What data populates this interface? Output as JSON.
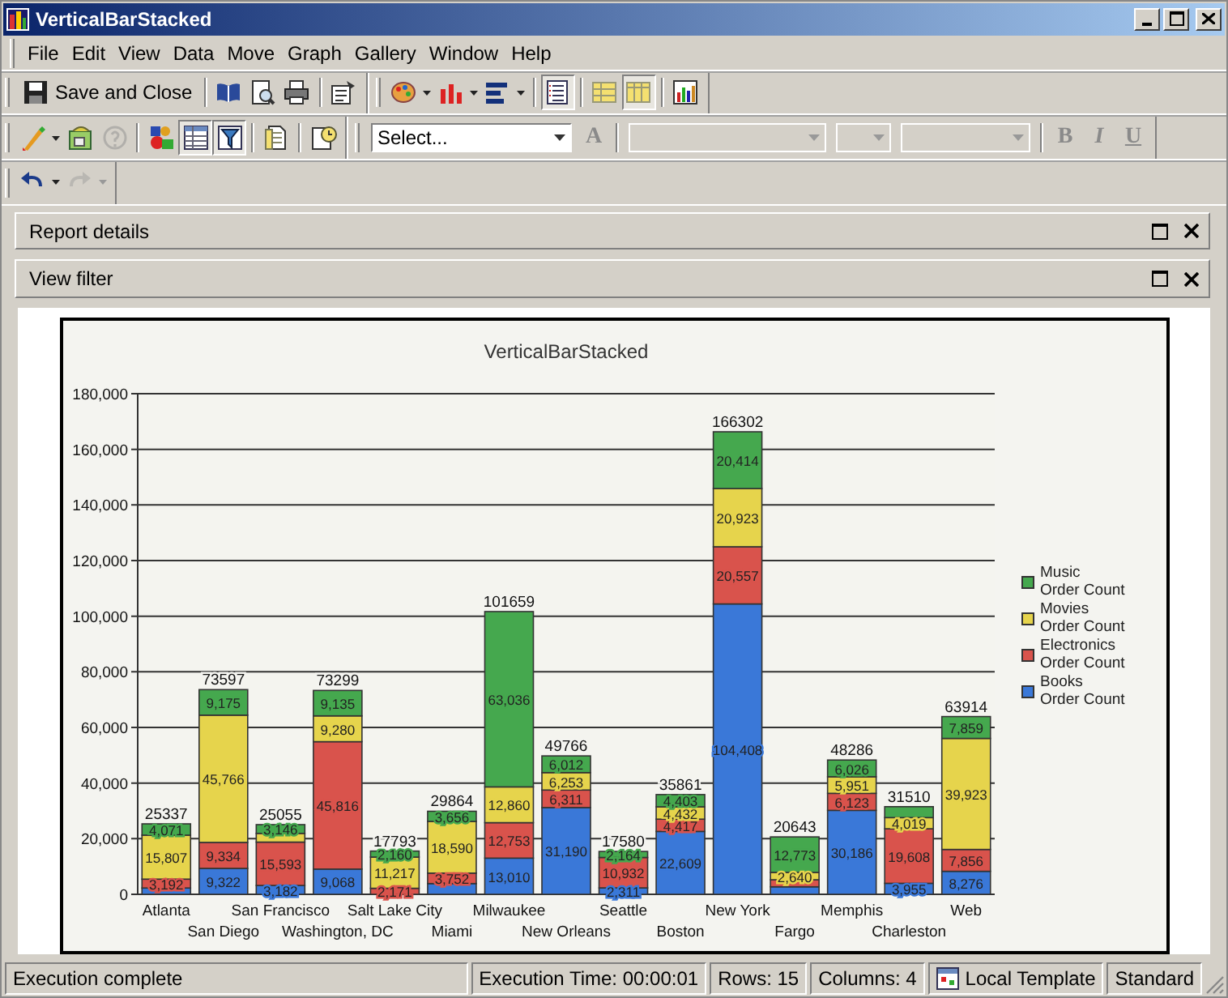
{
  "window": {
    "title": "VerticalBarStacked"
  },
  "menu": [
    "File",
    "Edit",
    "View",
    "Data",
    "Move",
    "Graph",
    "Gallery",
    "Window",
    "Help"
  ],
  "toolbar_rows": [
    {
      "bands": [
        {
          "items": [
            {
              "kind": "save",
              "label": "Save and Close",
              "pressed": false,
              "disabled": false,
              "dropdown": false
            },
            {
              "kind": "separator"
            },
            {
              "kind": "book",
              "pressed": false,
              "disabled": false,
              "dropdown": false
            },
            {
              "kind": "preview",
              "pressed": false,
              "disabled": false,
              "dropdown": false
            },
            {
              "kind": "print",
              "pressed": false,
              "disabled": false,
              "dropdown": false
            },
            {
              "kind": "separator"
            },
            {
              "kind": "properties",
              "pressed": false,
              "disabled": false,
              "dropdown": false
            }
          ]
        },
        {
          "items": [
            {
              "kind": "palette",
              "pressed": false,
              "disabled": false,
              "dropdown": true
            },
            {
              "kind": "bar-chart",
              "pressed": false,
              "disabled": false,
              "dropdown": true
            },
            {
              "kind": "hbar-chart",
              "pressed": false,
              "disabled": false,
              "dropdown": true
            },
            {
              "kind": "separator"
            },
            {
              "kind": "list",
              "pressed": true,
              "disabled": false,
              "dropdown": false
            },
            {
              "kind": "separator"
            },
            {
              "kind": "grid",
              "pressed": false,
              "disabled": false,
              "dropdown": false
            },
            {
              "kind": "columns",
              "pressed": true,
              "disabled": false,
              "dropdown": false
            },
            {
              "kind": "separator"
            },
            {
              "kind": "chart-export",
              "pressed": false,
              "disabled": false,
              "dropdown": false
            }
          ]
        }
      ]
    },
    {
      "bands": [
        {
          "items": [
            {
              "kind": "wand",
              "pressed": false,
              "disabled": false,
              "dropdown": true
            },
            {
              "kind": "image",
              "pressed": false,
              "disabled": false,
              "dropdown": false
            },
            {
              "kind": "help",
              "pressed": false,
              "disabled": true,
              "dropdown": false
            },
            {
              "kind": "separator"
            },
            {
              "kind": "shapes",
              "pressed": false,
              "disabled": false,
              "dropdown": false
            },
            {
              "kind": "table",
              "pressed": true,
              "disabled": false,
              "dropdown": false
            },
            {
              "kind": "filter",
              "pressed": true,
              "disabled": false,
              "dropdown": false
            },
            {
              "kind": "separator"
            },
            {
              "kind": "page",
              "pressed": false,
              "disabled": false,
              "dropdown": false
            },
            {
              "kind": "separator"
            },
            {
              "kind": "clock",
              "pressed": false,
              "disabled": false,
              "dropdown": false
            }
          ]
        },
        {
          "items": [
            {
              "kind": "combo",
              "value": "Select...",
              "disabled": false
            },
            {
              "kind": "font-color",
              "label": "A",
              "pressed": false,
              "disabled": true,
              "dropdown": false
            },
            {
              "kind": "separator"
            },
            {
              "kind": "font-combo",
              "disabled": true
            },
            {
              "kind": "size-combo",
              "disabled": true
            },
            {
              "kind": "style-combo",
              "disabled": true
            },
            {
              "kind": "separator"
            },
            {
              "kind": "bold",
              "label": "B",
              "pressed": false,
              "disabled": true,
              "dropdown": false
            },
            {
              "kind": "italic",
              "label": "I",
              "pressed": false,
              "disabled": true,
              "dropdown": false
            },
            {
              "kind": "underline",
              "label": "U",
              "pressed": false,
              "disabled": true,
              "dropdown": false
            }
          ]
        }
      ]
    },
    {
      "bands": [
        {
          "items": [
            {
              "kind": "undo",
              "pressed": false,
              "disabled": false,
              "dropdown": true
            },
            {
              "kind": "redo",
              "pressed": false,
              "disabled": true,
              "dropdown": true
            }
          ]
        }
      ]
    }
  ],
  "panels": [
    {
      "title": "Report details"
    },
    {
      "title": "View filter"
    }
  ],
  "chart": {
    "chart_data": {
      "type": "bar",
      "title": "VerticalBarStacked",
      "stacked": true,
      "orientation": "vertical",
      "data_labels": true,
      "grid": true,
      "legend": "right",
      "categories": [
        "Atlanta",
        "San Diego",
        "San Francisco",
        "Washington, DC",
        "Salt Lake City",
        "Miami",
        "Milwaukee",
        "New Orleans",
        "Seattle",
        "Boston",
        "New York",
        "Fargo",
        "Memphis",
        "Charleston",
        "Web"
      ],
      "ylim": [
        0,
        180000
      ],
      "yticks": [
        {
          "value": 0,
          "label": "0"
        },
        {
          "value": 20000,
          "label": "20,000"
        },
        {
          "value": 40000,
          "label": "40,000"
        },
        {
          "value": 60000,
          "label": "60,000"
        },
        {
          "value": 80000,
          "label": "80,000"
        },
        {
          "value": 100000,
          "label": "100,000"
        },
        {
          "value": 120000,
          "label": "120,000"
        },
        {
          "value": 140000,
          "label": "140,000"
        },
        {
          "value": 160000,
          "label": "160,000"
        },
        {
          "value": 180000,
          "label": "180,000"
        }
      ],
      "series": [
        {
          "name": "Books Order Count",
          "color": "#3a78d8",
          "values": [
            2267,
            9322,
            3182,
            9068,
            null,
            3866,
            13010,
            31190,
            2311,
            22609,
            104408,
            2705,
            30186,
            3955,
            8276
          ],
          "value_labels": [
            null,
            "9,322",
            "3,182",
            "9,068",
            null,
            null,
            "13,010",
            "31,190",
            "2,311",
            "22,609",
            "104,408",
            null,
            "30,186",
            "3,955",
            "8,276"
          ]
        },
        {
          "name": "Electronics Order Count",
          "color": "#d9534c",
          "values": [
            3192,
            9334,
            15593,
            45816,
            2171,
            3752,
            12753,
            6311,
            10932,
            4417,
            20557,
            2525,
            6123,
            19608,
            7856
          ],
          "value_labels": [
            "3,192",
            "9,334",
            "15,593",
            "45,816",
            "2,171",
            "3,752",
            "12,753",
            "6,311",
            "10,932",
            "4,417",
            "20,557",
            null,
            "6,123",
            "19,608",
            "7,856"
          ]
        },
        {
          "name": "Movies Order Count",
          "color": "#e6d44c",
          "values": [
            15807,
            45766,
            3134,
            9280,
            11217,
            18590,
            12860,
            6253,
            null,
            4432,
            20923,
            2640,
            5951,
            4019,
            39923
          ],
          "value_labels": [
            "15,807",
            "45,766",
            null,
            "9,280",
            "11,217",
            "18,590",
            "12,860",
            "6,253",
            null,
            "4,432",
            "20,923",
            "2,640",
            "5,951",
            "4,019",
            "39,923"
          ]
        },
        {
          "name": "Music Order Count",
          "color": "#45a84e",
          "values": [
            4071,
            9175,
            3146,
            9135,
            2160,
            3656,
            63036,
            6012,
            2164,
            4403,
            20414,
            12773,
            6026,
            3928,
            7859
          ],
          "value_labels": [
            "4,071",
            "9,175",
            "3,146",
            "9,135",
            "2,160",
            "3,656",
            "63,036",
            "6,012",
            "2,164",
            "4,403",
            "20,414",
            "12,773",
            "6,026",
            null,
            "7,859"
          ]
        }
      ],
      "annotations": [
        {
          "text": "25337"
        },
        {
          "text": "73597"
        },
        {
          "text": "25055"
        },
        {
          "text": "73299"
        },
        {
          "text": "17793"
        },
        {
          "text": "29864"
        },
        {
          "text": "101659"
        },
        {
          "text": "49766"
        },
        {
          "text": "17580"
        },
        {
          "text": "35861"
        },
        {
          "text": "166302"
        },
        {
          "text": "20643"
        },
        {
          "text": "48286"
        },
        {
          "text": "31510"
        },
        {
          "text": "63914"
        }
      ]
    }
  },
  "status_bar": {
    "message": "Execution complete",
    "execution_time": "Execution Time: 00:00:01",
    "rows": "Rows: 15",
    "columns": "Columns: 4",
    "template": "Local Template",
    "mode": "Standard"
  }
}
